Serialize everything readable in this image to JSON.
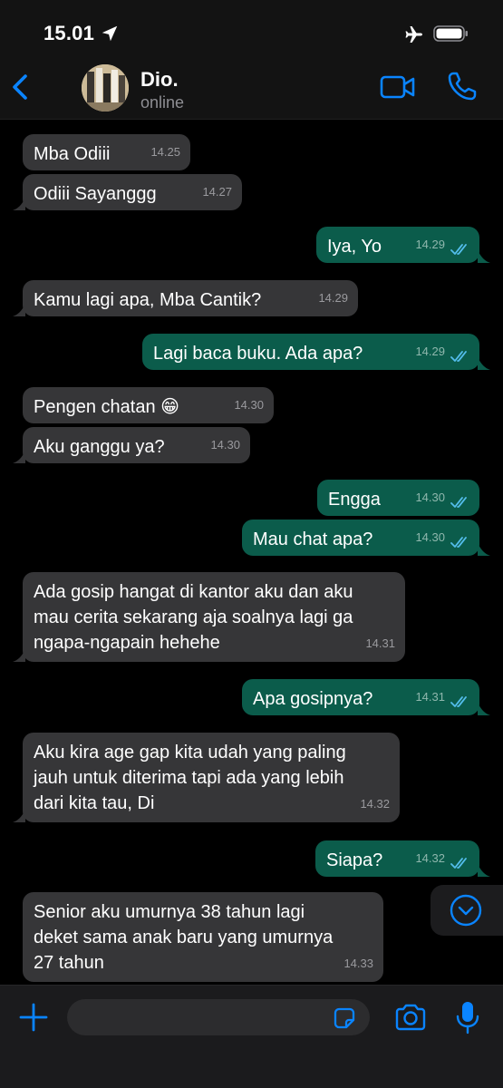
{
  "status_bar": {
    "time": "15.01",
    "icons": [
      "location-arrow-icon",
      "airplane-icon",
      "battery-icon"
    ]
  },
  "header": {
    "contact_name": "Dio.",
    "contact_status": "online",
    "icons": [
      "back-chevron-icon",
      "video-call-icon",
      "phone-icon"
    ]
  },
  "colors": {
    "accent": "#0a84ff",
    "incoming_bubble": "#363638",
    "outgoing_bubble": "#0b5c4b",
    "read_ticks": "#53bdeb",
    "background": "#000000"
  },
  "messages": [
    {
      "dir": "in",
      "text": "Mba Odiii",
      "time": "14.25"
    },
    {
      "dir": "in",
      "text": "Odiii Sayanggg",
      "time": "14.27"
    },
    {
      "dir": "out",
      "text": "Iya, Yo",
      "time": "14.29",
      "status": "read"
    },
    {
      "dir": "in",
      "text": "Kamu lagi apa, Mba Cantik?",
      "time": "14.29"
    },
    {
      "dir": "out",
      "text": "Lagi baca buku. Ada apa?",
      "time": "14.29",
      "status": "read"
    },
    {
      "dir": "in",
      "text": "Pengen chatan 😁",
      "time": "14.30"
    },
    {
      "dir": "in",
      "text": "Aku ganggu ya?",
      "time": "14.30"
    },
    {
      "dir": "out",
      "text": "Engga",
      "time": "14.30",
      "status": "read"
    },
    {
      "dir": "out",
      "text": "Mau chat apa?",
      "time": "14.30",
      "status": "read"
    },
    {
      "dir": "in",
      "text": "Ada gosip hangat di kantor aku dan aku\nmau cerita sekarang aja soalnya lagi ga\nngapa-ngapain hehehe",
      "time": "14.31"
    },
    {
      "dir": "out",
      "text": "Apa gosipnya?",
      "time": "14.31",
      "status": "read"
    },
    {
      "dir": "in",
      "text": "Aku kira age gap kita udah yang paling\njauh untuk diterima tapi ada yang lebih\ndari kita tau, Di",
      "time": "14.32"
    },
    {
      "dir": "out",
      "text": "Siapa?",
      "time": "14.32",
      "status": "read"
    },
    {
      "dir": "in",
      "text": "Senior aku umurnya 38 tahun lagi\ndeket sama anak baru yang umurnya\n27 tahun",
      "time": "14.33"
    }
  ],
  "input": {
    "value": "",
    "placeholder": ""
  },
  "input_icons": [
    "plus-icon",
    "sticker-icon",
    "camera-icon",
    "microphone-icon"
  ],
  "scroll_down_icon": "chevron-down-circle-icon"
}
